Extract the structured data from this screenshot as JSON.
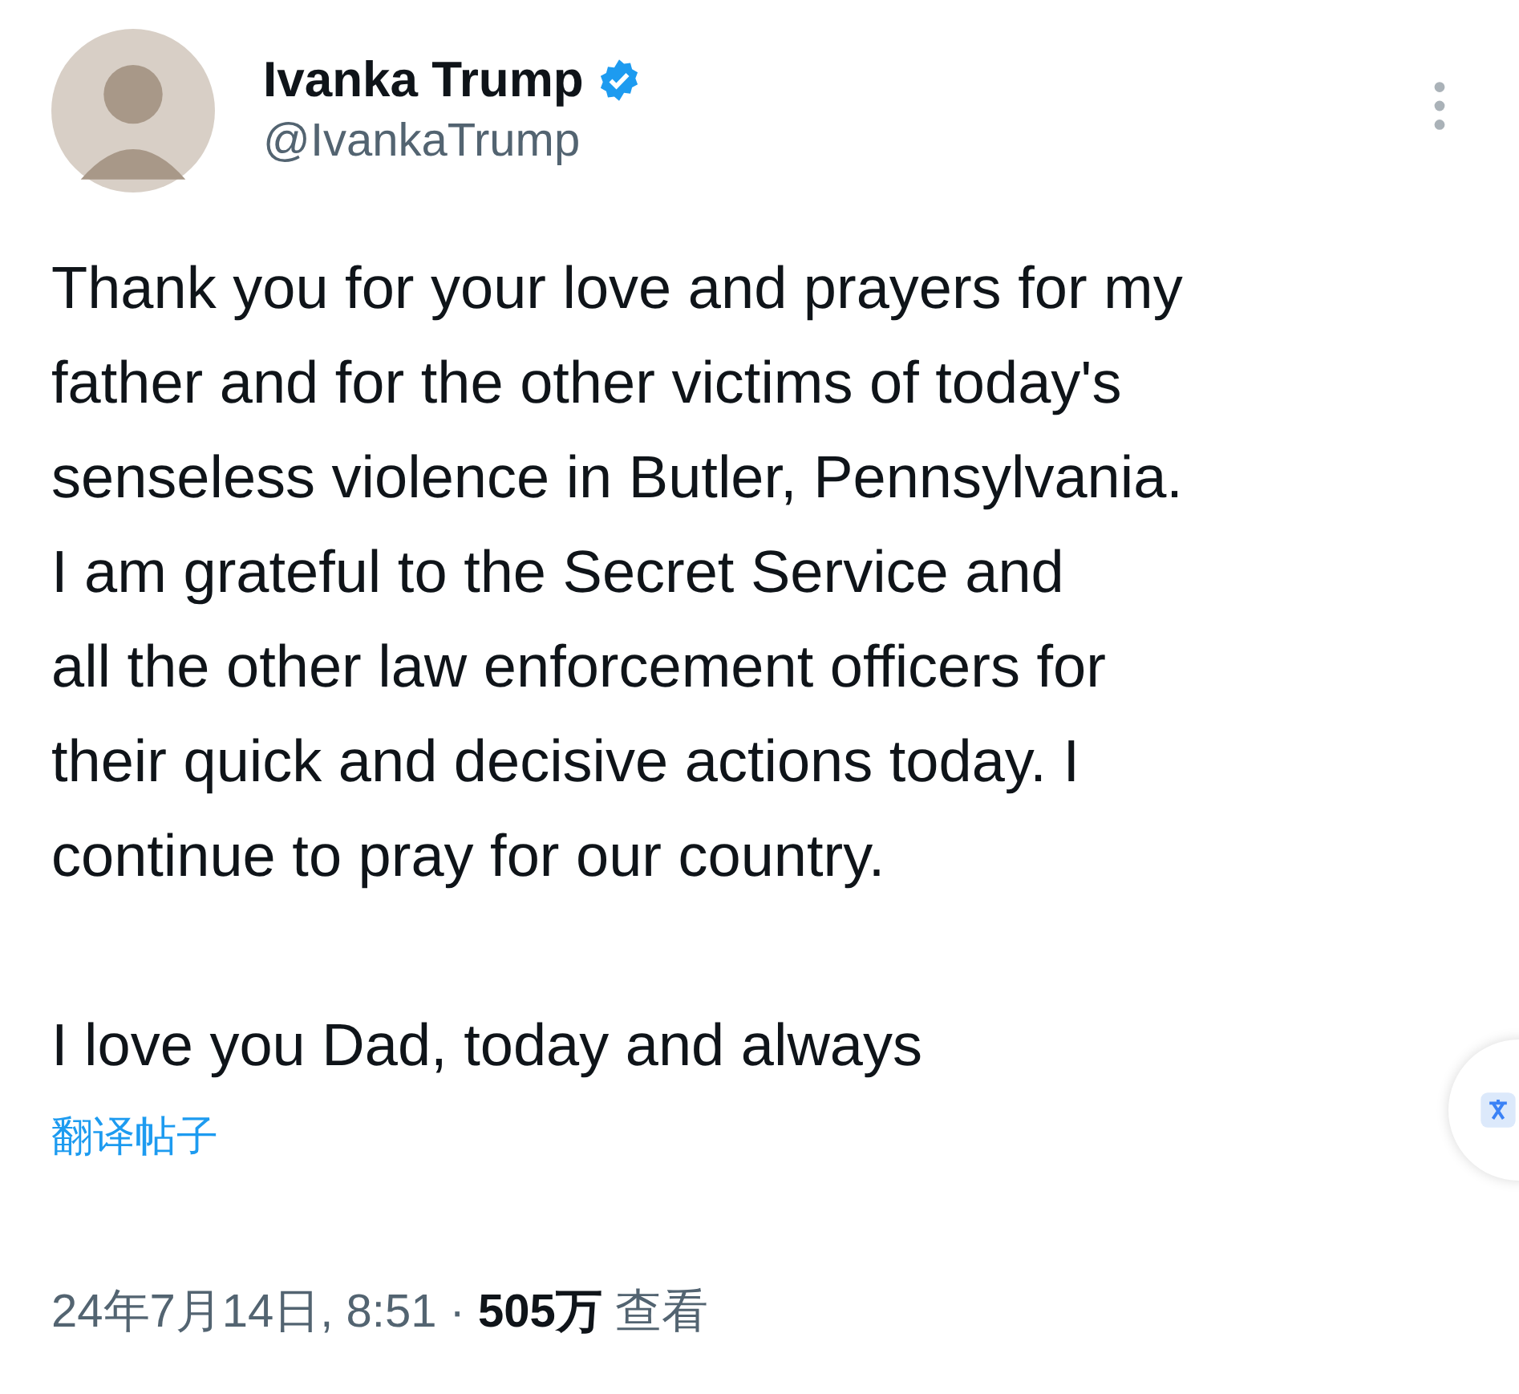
{
  "author": {
    "name": "Ivanka Trump",
    "verified": true,
    "handle": "@IvankaTrump"
  },
  "post": {
    "text": "Thank you for your love and prayers for my\nfather and for the other victims of today's\nsenseless violence in Butler, Pennsylvania.\nI am grateful to the Secret Service and\nall the other law enforcement officers for\ntheir quick and decisive actions today. I\ncontinue to pray for our country.\n\nI love you Dad, today and always"
  },
  "translate_link": "翻译帖子",
  "meta": "24年7月14日, 8:51 · **505万** 查看"
}
